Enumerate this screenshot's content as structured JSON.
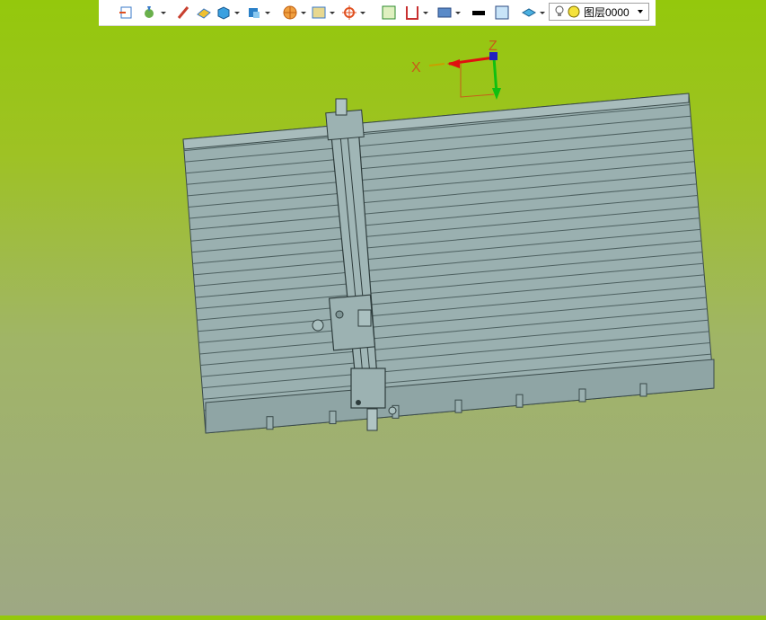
{
  "toolbar": {
    "buttons": [
      {
        "name": "import-icon",
        "has_dropdown": false
      },
      {
        "name": "operation-icon",
        "has_dropdown": true
      },
      {
        "name": "sketch-pen-icon",
        "has_dropdown": false
      },
      {
        "name": "eraser-icon",
        "has_dropdown": false
      },
      {
        "name": "solid-box-icon",
        "has_dropdown": true
      },
      {
        "name": "solid-style-icon",
        "has_dropdown": true
      },
      {
        "name": "render-wheel-icon",
        "has_dropdown": true
      },
      {
        "name": "view-frame-icon",
        "has_dropdown": true
      },
      {
        "name": "snap-target-icon",
        "has_dropdown": true
      },
      {
        "name": "zoom-fit-icon",
        "has_dropdown": false
      },
      {
        "name": "section-icon",
        "has_dropdown": true
      },
      {
        "name": "display-mode-icon",
        "has_dropdown": true
      },
      {
        "name": "line-color-icon",
        "has_dropdown": false
      },
      {
        "name": "fill-color-icon",
        "has_dropdown": false
      },
      {
        "name": "layer-manager-icon",
        "has_dropdown": true
      }
    ],
    "layer_select": {
      "value": "图层0000"
    }
  },
  "triad": {
    "x_label": "X",
    "z_label": "Z"
  },
  "colors": {
    "bg_top": "#94c80c",
    "bg_bottom": "#9ea884",
    "model_fill": "#9ab0b0",
    "model_edge": "#3a4a4a",
    "x_axis": "#e01010",
    "y_axis": "#10c010",
    "z_axis": "#2020c0"
  }
}
